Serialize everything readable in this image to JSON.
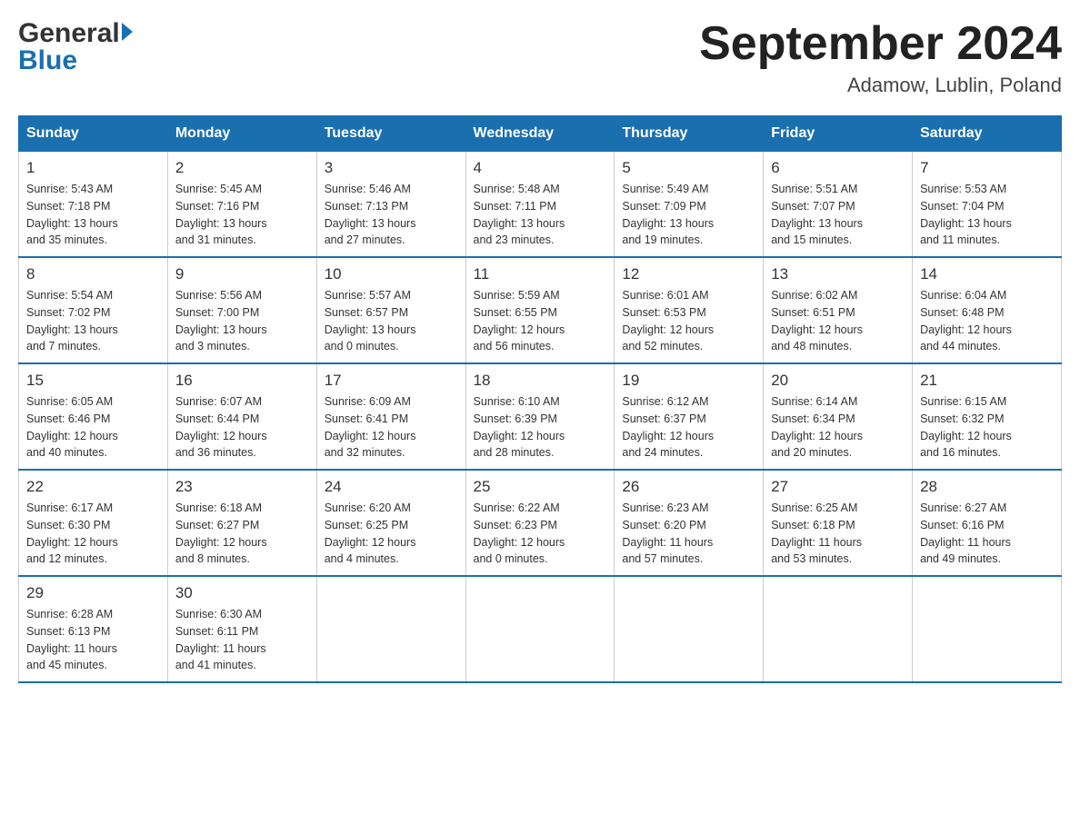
{
  "header": {
    "month_title": "September 2024",
    "location": "Adamow, Lublin, Poland",
    "logo_general": "General",
    "logo_blue": "Blue"
  },
  "days_of_week": [
    "Sunday",
    "Monday",
    "Tuesday",
    "Wednesday",
    "Thursday",
    "Friday",
    "Saturday"
  ],
  "weeks": [
    [
      {
        "day": "1",
        "sunrise": "5:43 AM",
        "sunset": "7:18 PM",
        "daylight": "13 hours and 35 minutes."
      },
      {
        "day": "2",
        "sunrise": "5:45 AM",
        "sunset": "7:16 PM",
        "daylight": "13 hours and 31 minutes."
      },
      {
        "day": "3",
        "sunrise": "5:46 AM",
        "sunset": "7:13 PM",
        "daylight": "13 hours and 27 minutes."
      },
      {
        "day": "4",
        "sunrise": "5:48 AM",
        "sunset": "7:11 PM",
        "daylight": "13 hours and 23 minutes."
      },
      {
        "day": "5",
        "sunrise": "5:49 AM",
        "sunset": "7:09 PM",
        "daylight": "13 hours and 19 minutes."
      },
      {
        "day": "6",
        "sunrise": "5:51 AM",
        "sunset": "7:07 PM",
        "daylight": "13 hours and 15 minutes."
      },
      {
        "day": "7",
        "sunrise": "5:53 AM",
        "sunset": "7:04 PM",
        "daylight": "13 hours and 11 minutes."
      }
    ],
    [
      {
        "day": "8",
        "sunrise": "5:54 AM",
        "sunset": "7:02 PM",
        "daylight": "13 hours and 7 minutes."
      },
      {
        "day": "9",
        "sunrise": "5:56 AM",
        "sunset": "7:00 PM",
        "daylight": "13 hours and 3 minutes."
      },
      {
        "day": "10",
        "sunrise": "5:57 AM",
        "sunset": "6:57 PM",
        "daylight": "13 hours and 0 minutes."
      },
      {
        "day": "11",
        "sunrise": "5:59 AM",
        "sunset": "6:55 PM",
        "daylight": "12 hours and 56 minutes."
      },
      {
        "day": "12",
        "sunrise": "6:01 AM",
        "sunset": "6:53 PM",
        "daylight": "12 hours and 52 minutes."
      },
      {
        "day": "13",
        "sunrise": "6:02 AM",
        "sunset": "6:51 PM",
        "daylight": "12 hours and 48 minutes."
      },
      {
        "day": "14",
        "sunrise": "6:04 AM",
        "sunset": "6:48 PM",
        "daylight": "12 hours and 44 minutes."
      }
    ],
    [
      {
        "day": "15",
        "sunrise": "6:05 AM",
        "sunset": "6:46 PM",
        "daylight": "12 hours and 40 minutes."
      },
      {
        "day": "16",
        "sunrise": "6:07 AM",
        "sunset": "6:44 PM",
        "daylight": "12 hours and 36 minutes."
      },
      {
        "day": "17",
        "sunrise": "6:09 AM",
        "sunset": "6:41 PM",
        "daylight": "12 hours and 32 minutes."
      },
      {
        "day": "18",
        "sunrise": "6:10 AM",
        "sunset": "6:39 PM",
        "daylight": "12 hours and 28 minutes."
      },
      {
        "day": "19",
        "sunrise": "6:12 AM",
        "sunset": "6:37 PM",
        "daylight": "12 hours and 24 minutes."
      },
      {
        "day": "20",
        "sunrise": "6:14 AM",
        "sunset": "6:34 PM",
        "daylight": "12 hours and 20 minutes."
      },
      {
        "day": "21",
        "sunrise": "6:15 AM",
        "sunset": "6:32 PM",
        "daylight": "12 hours and 16 minutes."
      }
    ],
    [
      {
        "day": "22",
        "sunrise": "6:17 AM",
        "sunset": "6:30 PM",
        "daylight": "12 hours and 12 minutes."
      },
      {
        "day": "23",
        "sunrise": "6:18 AM",
        "sunset": "6:27 PM",
        "daylight": "12 hours and 8 minutes."
      },
      {
        "day": "24",
        "sunrise": "6:20 AM",
        "sunset": "6:25 PM",
        "daylight": "12 hours and 4 minutes."
      },
      {
        "day": "25",
        "sunrise": "6:22 AM",
        "sunset": "6:23 PM",
        "daylight": "12 hours and 0 minutes."
      },
      {
        "day": "26",
        "sunrise": "6:23 AM",
        "sunset": "6:20 PM",
        "daylight": "11 hours and 57 minutes."
      },
      {
        "day": "27",
        "sunrise": "6:25 AM",
        "sunset": "6:18 PM",
        "daylight": "11 hours and 53 minutes."
      },
      {
        "day": "28",
        "sunrise": "6:27 AM",
        "sunset": "6:16 PM",
        "daylight": "11 hours and 49 minutes."
      }
    ],
    [
      {
        "day": "29",
        "sunrise": "6:28 AM",
        "sunset": "6:13 PM",
        "daylight": "11 hours and 45 minutes."
      },
      {
        "day": "30",
        "sunrise": "6:30 AM",
        "sunset": "6:11 PM",
        "daylight": "11 hours and 41 minutes."
      },
      null,
      null,
      null,
      null,
      null
    ]
  ]
}
